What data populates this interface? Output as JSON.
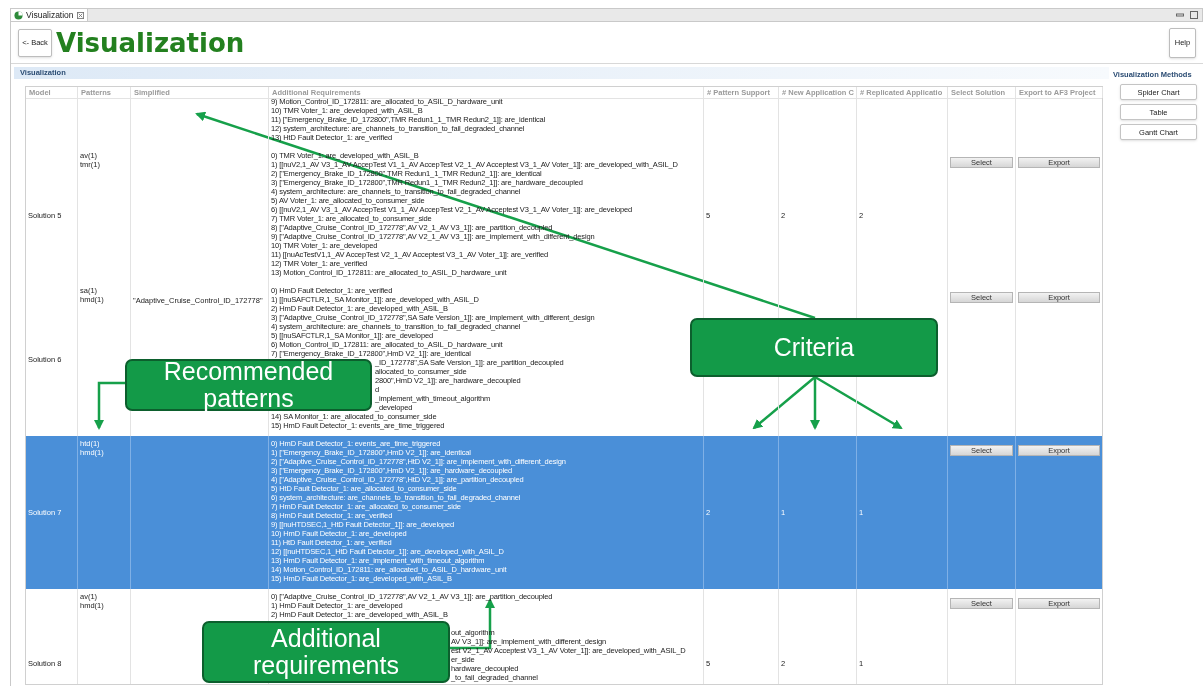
{
  "tab": {
    "title": "Visualization"
  },
  "header": {
    "back_button": "<- Back",
    "title": "Visualization",
    "help_button": "Help"
  },
  "section": {
    "title": "Visualization"
  },
  "table": {
    "columns": [
      "Model",
      "Patterns",
      "Simplified",
      "Additional Requirements",
      "# Pattern Support",
      "# New Application C",
      "# Replicated Applicatio",
      "Select Solution",
      "Export to AF3 Project"
    ],
    "rows": [
      {
        "selected": false,
        "requirements": [
          {
            "text": "9) Motion_Control_ID_172811: are_allocated_to_ASIL_D_hardware_unit"
          },
          {
            "text": "10) TMR Voter_1: are_developed_with_ASIL_B"
          },
          {
            "text": "11) [\"Emergency_Brake_ID_172800\",TMR Redun1_1_TMR Redun2_1]]: are_identical"
          },
          {
            "text": "12) system_architecture: are_channels_to_transition_to_fail_degraded_channel"
          },
          {
            "text": "13) HtD Fault Detector_1: are_verified"
          }
        ]
      },
      {
        "selected": false,
        "model": "Solution 5",
        "patterns": [
          "av(1)",
          "tmr(1)"
        ],
        "requirements": [
          {
            "text": "0) TMR Voter_1: are_developed_with_ASIL_B"
          },
          {
            "text": "1) [[nuV2,1_AV V3_1_AV AccepTest V1_1_AV AccepTest V2_1_AV Acceptest V3_1_AV Voter_1]]: are_developed_with_ASIL_D"
          },
          {
            "text": "2) [\"Emergency_Brake_ID_172800\",TMR Redun1_1_TMR Redun2_1]]: are_identical"
          },
          {
            "text": "3) [\"Emergency_Brake_ID_172800\",TMR Redun1_1_TMR Redun2_1]]: are_hardware_decoupled"
          },
          {
            "text": "4) system_architecture: are_channels_to_transition_to_fail_degraded_channel"
          },
          {
            "text": "5) AV Voter_1: are_allocated_to_consumer_side"
          },
          {
            "text": "6) [[nuV2,1_AV V3_1_AV AccepTest V1_1_AV AccepTest V2_1_AV Acceptest V3_1_AV Voter_1]]: are_developed"
          },
          {
            "text": "7) TMR Voter_1: are_allocated_to_consumer_side"
          },
          {
            "text": "8) [\"Adaptive_Cruise_Control_ID_172778\",AV V2_1_AV V3_1]]: are_partition_decoupled"
          },
          {
            "text": "9) [\"Adaptive_Cruise_Control_ID_172778\",AV V2_1_AV V3_1]]: are_implement_with_different_design"
          },
          {
            "text": "10) TMR Voter_1: are_developed"
          },
          {
            "text": "11) [[nuAcTestV1,1_AV AccepTest V2_1_AV Acceptest V3_1_AV Voter_1]]: are_verified"
          },
          {
            "text": "12) TMR Voter_1: are_verified"
          },
          {
            "text": "13) Motion_Control_ID_172811: are_allocated_to_ASIL_D_hardware_unit"
          }
        ],
        "pattern_support": "5",
        "new_application": "2",
        "replicated_application": "2",
        "select_button": "Select",
        "export_button": "Export"
      },
      {
        "selected": false,
        "model": "Solution 6",
        "patterns": [
          "sa(1)",
          "hmd(1)"
        ],
        "simplified": "\"Adaptive_Cruise_Control_ID_172778\"",
        "requirements": [
          {
            "text": "0) HmD Fault Detector_1: are_verified"
          },
          {
            "text": "1) [[nuSAFCTLR,1_SA Monitor_1]]: are_developed_with_ASIL_D"
          },
          {
            "text": "2) HmD Fault Detector_1: are_developed_with_ASIL_B"
          },
          {
            "text": "3) [\"Adaptive_Cruise_Control_ID_172778\",SA Safe Version_1]]: are_implement_with_different_design"
          },
          {
            "text": "4) system_architecture: are_channels_to_transition_to_fail_degraded_channel"
          },
          {
            "text": "5) [[nuSAFCTLR,1_SA Monitor_1]]: are_developed"
          },
          {
            "text": "6) Motion_Control_ID_172811: are_allocated_to_ASIL_D_hardware_unit"
          },
          {
            "text": "7) [\"Emergency_Brake_ID_172800\",HmD V2_1]]: are_identical"
          },
          {
            "text": "_ID_172778\",SA Safe Version_1]]: are_partition_decoupled",
            "covered": true
          },
          {
            "text": "allocated_to_consumer_side",
            "covered": true
          },
          {
            "text": "2800\",HmD V2_1]]: are_hardware_decoupled",
            "covered": true
          },
          {
            "text": "d",
            "covered": true
          },
          {
            "text": "_implement_with_timeout_algorithm",
            "covered": true
          },
          {
            "text": "_developed",
            "covered": true
          },
          {
            "text": "14) SA Monitor_1: are_allocated_to_consumer_side"
          },
          {
            "text": "15) HmD Fault Detector_1: events_are_time_triggered"
          }
        ],
        "select_button": "Select",
        "export_button": "Export"
      },
      {
        "selected": true,
        "model": "Solution 7",
        "patterns": [
          "htd(1)",
          "hmd(1)"
        ],
        "requirements": [
          {
            "text": "0) HmD Fault Detector_1: events_are_time_triggered"
          },
          {
            "text": "1) [\"Emergency_Brake_ID_172800\",HmD V2_1]]: are_identical"
          },
          {
            "text": "2) [\"Adaptive_Cruise_Control_ID_172778\",HtD V2_1]]: are_implement_with_different_design"
          },
          {
            "text": "3) [\"Emergency_Brake_ID_172800\",HmD V2_1]]: are_hardware_decoupled"
          },
          {
            "text": "4) [\"Adaptive_Cruise_Control_ID_172778\",HtD V2_1]]: are_partition_decoupled"
          },
          {
            "text": "5) HtD Fault Detector_1: are_allocated_to_consumer_side"
          },
          {
            "text": "6) system_architecture: are_channels_to_transition_to_fail_degraded_channel"
          },
          {
            "text": "7) HmD Fault Detector_1: are_allocated_to_consumer_side"
          },
          {
            "text": "8) HmD Fault Detector_1: are_verified"
          },
          {
            "text": "9) [[nuHTDSEC,1_HtD Fault Detector_1]]: are_developed"
          },
          {
            "text": "10) HmD Fault Detector_1: are_developed"
          },
          {
            "text": "11) HtD Fault Detector_1: are_verified"
          },
          {
            "text": "12) [[nuHTDSEC,1_HtD Fault Detector_1]]: are_developed_with_ASIL_D"
          },
          {
            "text": "13) HmD Fault Detector_1: are_implement_with_timeout_algorithm"
          },
          {
            "text": "14) Motion_Control_ID_172811: are_allocated_to_ASIL_D_hardware_unit"
          },
          {
            "text": "15) HmD Fault Detector_1: are_developed_with_ASIL_B"
          }
        ],
        "pattern_support": "2",
        "new_application": "1",
        "replicated_application": "1",
        "select_button": "Select",
        "export_button": "Export"
      },
      {
        "selected": false,
        "model": "Solution 8",
        "patterns": [
          "av(1)",
          "hmd(1)"
        ],
        "requirements": [
          {
            "text": "0) [\"Adaptive_Cruise_Control_ID_172778\",AV V2_1_AV V3_1]]: are_partition_decoupled"
          },
          {
            "text": "1) HmD Fault Detector_1: are_developed"
          },
          {
            "text": "2) HmD Fault Detector_1: are_developed_with_ASIL_B"
          },
          {
            "covered": true
          },
          {
            "text": "out_algorithm",
            "covered": true
          },
          {
            "text": "AV V3_1]]: are_implement_with_different_design",
            "covered": true
          },
          {
            "text": "est V2_1_AV Acceptest V3_1_AV Voter_1]]: are_developed_with_ASIL_D",
            "covered": true
          },
          {
            "text": "er_side",
            "covered": true
          },
          {
            "text": "hardware_decoupled",
            "covered": true
          },
          {
            "text": "_to_fail_degraded_channel",
            "covered": true
          }
        ],
        "pattern_support": "5",
        "new_application": "2",
        "replicated_application": "1",
        "select_button": "Select",
        "export_button": "Export"
      }
    ]
  },
  "side_panel": {
    "title": "Visualization Methods",
    "buttons": [
      "Spider Chart",
      "Table",
      "Gantt Chart"
    ]
  },
  "callouts": [
    {
      "kind": "criteria",
      "lines": [
        "Criteria"
      ]
    },
    {
      "kind": "patterns",
      "lines": [
        "Recommended",
        "patterns"
      ]
    },
    {
      "kind": "requirements",
      "lines": [
        "Additional",
        "requirements"
      ]
    }
  ]
}
